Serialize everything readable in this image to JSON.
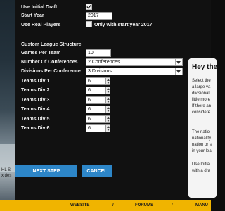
{
  "background": {
    "text_lines": [
      "HL S",
      "x des"
    ]
  },
  "settings": {
    "use_initial_draft": {
      "label": "Use Initial Draft",
      "checked": true
    },
    "start_year": {
      "label": "Start Year",
      "value": "2017"
    },
    "use_real_players": {
      "label": "Use Real Players",
      "checked": false,
      "option_label": "Only with start year 2017",
      "option_checked": false
    }
  },
  "custom_structure": {
    "heading": "Custom League Structure",
    "games_per_team": {
      "label": "Games Per Team",
      "value": "10"
    },
    "number_of_conferences": {
      "label": "Number Of Conferences",
      "value": "2 Conferences"
    },
    "divisions_per_conference": {
      "label": "Divisions Per Conference",
      "value": "3 Divisions"
    },
    "teams_div": [
      {
        "label": "Teams Div 1",
        "value": "6"
      },
      {
        "label": "Teams Div 2",
        "value": "6"
      },
      {
        "label": "Teams Div 3",
        "value": "6"
      },
      {
        "label": "Teams Div 4",
        "value": "6"
      },
      {
        "label": "Teams Div 5",
        "value": "6"
      },
      {
        "label": "Teams Div 6",
        "value": "6"
      }
    ]
  },
  "buttons": {
    "next_step": "NEXT STEP",
    "cancel": "CANCEL"
  },
  "help": {
    "title": "Hey the",
    "lines": [
      "Select the",
      "a large va",
      "divisional",
      "little more",
      "If there an",
      "considere",
      "",
      "The natio",
      "nationality",
      "nation or s",
      "in your lea",
      "",
      "Use Initial",
      "with a dra"
    ]
  },
  "footer": {
    "links": [
      "WEBSITE",
      "FORUMS",
      "MANU"
    ],
    "separator": "/"
  },
  "colors": {
    "accent": "#2d86c8",
    "footer": "#f0b400"
  }
}
